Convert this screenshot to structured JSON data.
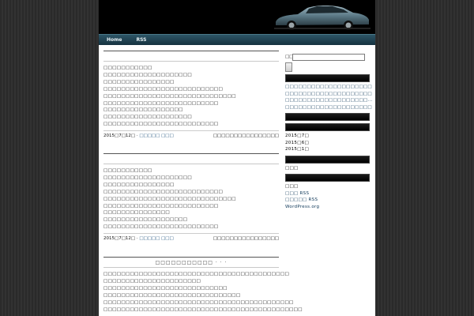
{
  "nav": {
    "items": [
      "Home",
      "RSS"
    ]
  },
  "posts": [
    {
      "title": "",
      "lines": [
        "□□□□□□□□□□□",
        "□□□□□□□□□□□□□□□□□□□□",
        "□□□□□□□□□□□□□□□□",
        "□□□□□□□□□□□□□□□□□□□□□□□□□□□",
        "□□□□□□□□□□□□□□□□□□□□□□□□□□□□□□",
        "□□□□□□□□□□□□□□□□□□□□□□□□□□",
        "□□□□□□□□□□□□□□□□□□",
        "□□□□□□□□□□□□□□□□□□□□",
        "□□□□□□□□□□□□□□□□□□□□□□□□□□"
      ],
      "date": "2015□7□12□ ·",
      "author": "□□□□□ □□□",
      "comments": "□□□□□□□□□□□□□□□□"
    },
    {
      "title": "",
      "lines": [
        "□□□□□□□□□□□",
        "□□□□□□□□□□□□□□□□□□□□",
        "□□□□□□□□□□□□□□□□",
        "□□□□□□□□□□□□□□□□□□□□□□□□□□□",
        "□□□□□□□□□□□□□□□□□□□□□□□□□□□□□□",
        "□□□□□□□□□□□□□□□□□□□□□□□□□□",
        "□□□□□□□□□□□□□□□",
        "□□□□□□□□□□□□□□□□□□□",
        "□□□□□□□□□□□□□□□□□□□□□□□□□□"
      ],
      "date": "2015□7□12□ ·",
      "author": "□□□□□ □□□",
      "comments": "□□□□□□□□□□□□□□□□"
    },
    {
      "title": "□□□□□□□□□□□ · · ·",
      "lines": [
        "□□□□□□□□□□□□□□□□□□□□□□□□□□□□□□□□□□□□□□□□□□",
        "□□□□□□□□□□□□□□□□□□□□□□",
        "□□□□□□□□□□□□□□□□□□□□□□□□□□□□",
        "□□□□□□□□□□□□□□□□□□□□□□□□□□□□□□□",
        "□□□□□□□□□□□□□□□□□□□□□□□□□□□□□□□□□□□□□□□□□□□",
        "□□□□□□□□□□□□□□□□□□□□□□□□□□□□□□□□□□□□□□□□□□□□□"
      ]
    }
  ],
  "sidebar": {
    "search_label": "□□",
    "search_value": "",
    "recent": [
      "□□□□□□□□□□□□□□□□□□□□",
      "□□□□□□□□□□□□□□□□□□□□",
      "□□□□□□□□□□□□□□□□□□□...",
      "□□□□□□□□□□□□□□□□□□□□"
    ],
    "archives": [
      "2015□7□",
      "2015□6□",
      "2015□1□"
    ],
    "categories": [
      "□□□"
    ],
    "meta": [
      "□□□",
      "□□□ RSS",
      "□□□□□ RSS",
      "WordPress.org"
    ]
  }
}
